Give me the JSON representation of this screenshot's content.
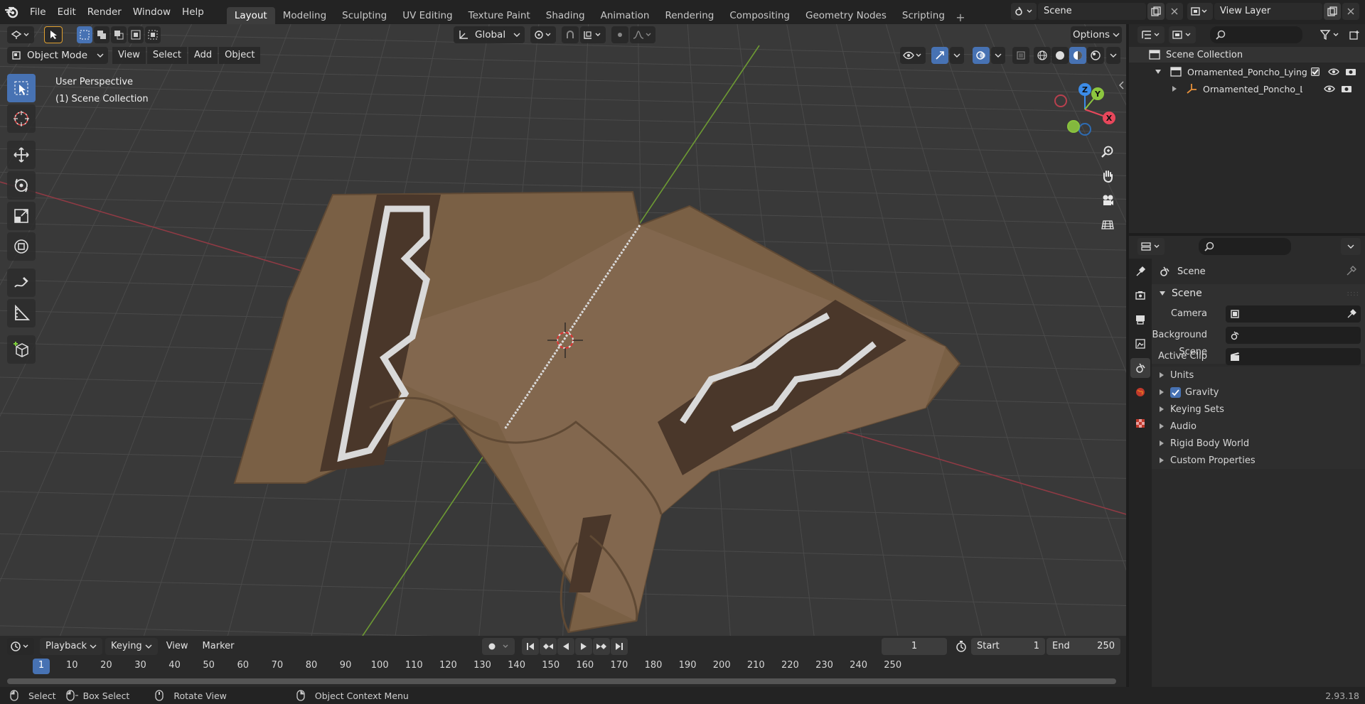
{
  "topbar": {
    "menus": [
      "File",
      "Edit",
      "Render",
      "Window",
      "Help"
    ],
    "workspaces": [
      "Layout",
      "Modeling",
      "Sculpting",
      "UV Editing",
      "Texture Paint",
      "Shading",
      "Animation",
      "Rendering",
      "Compositing",
      "Geometry Nodes",
      "Scripting"
    ],
    "active_workspace": "Layout",
    "add_tab": "+",
    "scene_name": "Scene",
    "view_layer_name": "View Layer"
  },
  "viewport": {
    "transform_orientation": "Global",
    "options_label": "Options",
    "mode": "Object Mode",
    "header_menus": [
      "View",
      "Select",
      "Add",
      "Object"
    ],
    "perspective": "User Perspective",
    "collection": "(1) Scene Collection",
    "gizmo_axes": {
      "x": "X",
      "y": "Y",
      "z": "Z"
    },
    "colors": {
      "x_axis": "#e8475b",
      "y_axis": "#8cc63f",
      "z_axis": "#3c8ce8",
      "active": "#4772b3"
    }
  },
  "outliner": {
    "root": "Scene Collection",
    "items": [
      {
        "label": "Ornamented_Poncho_Lying_(",
        "type": "collection"
      },
      {
        "label": "Ornamented_Poncho_Ly",
        "type": "object"
      }
    ]
  },
  "properties": {
    "context": "Scene",
    "panel_title": "Scene",
    "fields": [
      {
        "label": "Camera"
      },
      {
        "label": "Background Scene"
      },
      {
        "label": "Active Clip"
      }
    ],
    "subpanels": [
      "Units",
      "Gravity",
      "Keying Sets",
      "Audio",
      "Rigid Body World",
      "Custom Properties"
    ],
    "gravity_checked": true
  },
  "timeline": {
    "menus": [
      "Playback",
      "Keying",
      "View",
      "Marker"
    ],
    "current_frame": "1",
    "start_label": "Start",
    "start_value": "1",
    "end_label": "End",
    "end_value": "250",
    "ruler": [
      "1",
      "10",
      "20",
      "30",
      "40",
      "50",
      "60",
      "70",
      "80",
      "90",
      "100",
      "110",
      "120",
      "130",
      "140",
      "150",
      "160",
      "170",
      "180",
      "190",
      "200",
      "210",
      "220",
      "230",
      "240",
      "250"
    ]
  },
  "statusbar": {
    "select": "Select",
    "box_select": "Box Select",
    "rotate_view": "Rotate View",
    "context_menu": "Object Context Menu",
    "version": "2.93.18"
  }
}
